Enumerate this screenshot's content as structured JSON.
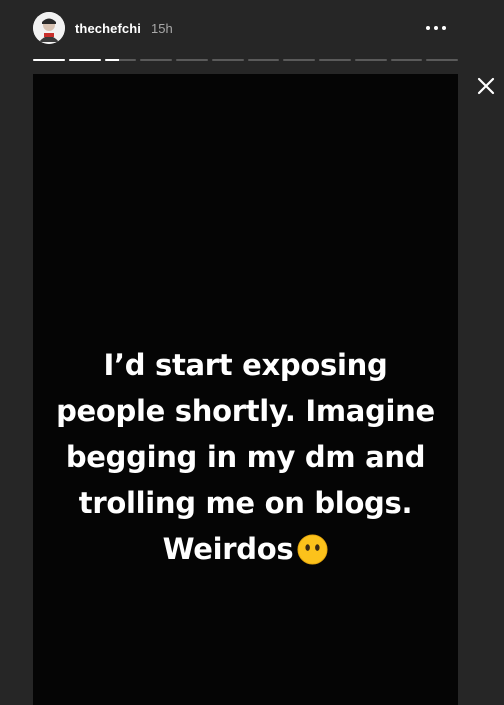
{
  "header": {
    "username": "thechefchi",
    "timestamp": "15h",
    "avatar_icon": "profile-photo-icon",
    "more_icon": "more-options-icon"
  },
  "progress": {
    "segments": 12,
    "completed": 2,
    "current_fraction": 0.45
  },
  "story": {
    "lines": [
      "I’d start exposing",
      "people shortly. Imagine",
      "begging in my dm and",
      "trolling me on blogs.",
      "Weirdos"
    ],
    "emoji": "face-without-mouth-emoji",
    "background_color": "#050505",
    "text_color": "#ffffff"
  },
  "controls": {
    "close_icon": "close-icon"
  },
  "colors": {
    "page_background": "#262626",
    "timestamp": "#a8a8a8",
    "progress_track": "#5a5a5a",
    "progress_fill": "#ffffff",
    "emoji_face": "#fcc21b"
  }
}
